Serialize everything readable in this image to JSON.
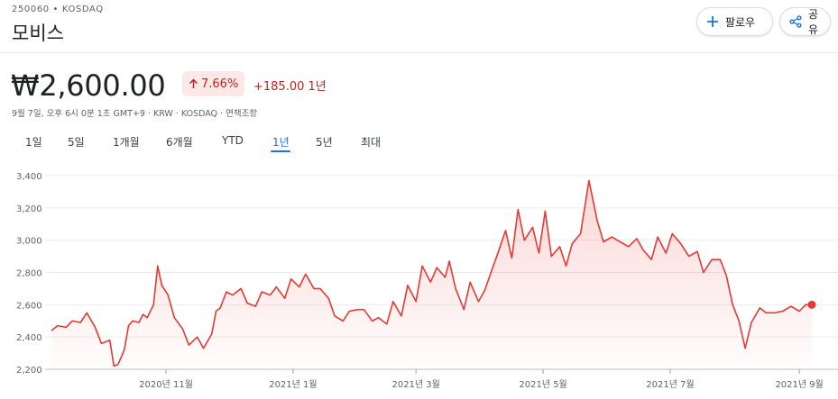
{
  "header": {
    "ticker": "250060 • KOSDAQ",
    "name": "모비스",
    "follow_label": "팔로우",
    "share_label": "공유"
  },
  "quote": {
    "price": "₩2,600.00",
    "change_pct": "7.66%",
    "change_abs": "+185.00 1년",
    "meta": "9월 7일, 오후 6시 0분 1초 GMT+9 · KRW · KOSDAQ · 면책조항"
  },
  "tabs": [
    {
      "label": "1일",
      "active": false
    },
    {
      "label": "5일",
      "active": false
    },
    {
      "label": "1개월",
      "active": false
    },
    {
      "label": "6개월",
      "active": false
    },
    {
      "label": "YTD",
      "active": false
    },
    {
      "label": "1년",
      "active": true
    },
    {
      "label": "5년",
      "active": false
    },
    {
      "label": "최대",
      "active": false
    }
  ],
  "colors": {
    "line": "#e53935",
    "fill": "#fce8e6",
    "accent": "#1a73e8",
    "negative_text": "#c5221f"
  },
  "chart_data": {
    "type": "area",
    "y_ticks": [
      "3,400",
      "3,200",
      "3,000",
      "2,800",
      "2,600",
      "2,400",
      "2,200"
    ],
    "x_ticks": [
      "2020년 11월",
      "2021년 1월",
      "2021년 3월",
      "2021년 5월",
      "2021년 7월",
      "2021년 9월"
    ],
    "ylim": [
      2200,
      3400
    ],
    "x_range": [
      "2020-09-07",
      "2021-09-07"
    ],
    "last_value": 2600,
    "points": [
      [
        "2020-09-07",
        2440
      ],
      [
        "2020-09-10",
        2470
      ],
      [
        "2020-09-14",
        2460
      ],
      [
        "2020-09-17",
        2500
      ],
      [
        "2020-09-21",
        2490
      ],
      [
        "2020-09-24",
        2550
      ],
      [
        "2020-09-28",
        2460
      ],
      [
        "2020-10-01",
        2360
      ],
      [
        "2020-10-05",
        2380
      ],
      [
        "2020-10-07",
        2220
      ],
      [
        "2020-10-09",
        2230
      ],
      [
        "2020-10-12",
        2320
      ],
      [
        "2020-10-14",
        2470
      ],
      [
        "2020-10-16",
        2500
      ],
      [
        "2020-10-19",
        2490
      ],
      [
        "2020-10-21",
        2540
      ],
      [
        "2020-10-23",
        2520
      ],
      [
        "2020-10-26",
        2600
      ],
      [
        "2020-10-28",
        2840
      ],
      [
        "2020-10-30",
        2720
      ],
      [
        "2020-11-02",
        2660
      ],
      [
        "2020-11-05",
        2520
      ],
      [
        "2020-11-09",
        2450
      ],
      [
        "2020-11-12",
        2350
      ],
      [
        "2020-11-16",
        2400
      ],
      [
        "2020-11-19",
        2330
      ],
      [
        "2020-11-23",
        2420
      ],
      [
        "2020-11-25",
        2560
      ],
      [
        "2020-11-27",
        2580
      ],
      [
        "2020-11-30",
        2680
      ],
      [
        "2020-12-03",
        2660
      ],
      [
        "2020-12-07",
        2700
      ],
      [
        "2020-12-10",
        2610
      ],
      [
        "2020-12-14",
        2590
      ],
      [
        "2020-12-17",
        2680
      ],
      [
        "2020-12-21",
        2660
      ],
      [
        "2020-12-24",
        2710
      ],
      [
        "2020-12-28",
        2640
      ],
      [
        "2020-12-31",
        2760
      ],
      [
        "2021-01-04",
        2710
      ],
      [
        "2021-01-07",
        2790
      ],
      [
        "2021-01-11",
        2700
      ],
      [
        "2021-01-14",
        2700
      ],
      [
        "2021-01-18",
        2640
      ],
      [
        "2021-01-21",
        2530
      ],
      [
        "2021-01-25",
        2500
      ],
      [
        "2021-01-28",
        2560
      ],
      [
        "2021-02-01",
        2570
      ],
      [
        "2021-02-04",
        2570
      ],
      [
        "2021-02-08",
        2500
      ],
      [
        "2021-02-11",
        2520
      ],
      [
        "2021-02-15",
        2480
      ],
      [
        "2021-02-18",
        2620
      ],
      [
        "2021-02-22",
        2530
      ],
      [
        "2021-02-25",
        2720
      ],
      [
        "2021-03-01",
        2620
      ],
      [
        "2021-03-04",
        2840
      ],
      [
        "2021-03-08",
        2740
      ],
      [
        "2021-03-11",
        2830
      ],
      [
        "2021-03-15",
        2770
      ],
      [
        "2021-03-17",
        2870
      ],
      [
        "2021-03-20",
        2700
      ],
      [
        "2021-03-24",
        2570
      ],
      [
        "2021-03-27",
        2740
      ],
      [
        "2021-03-31",
        2620
      ],
      [
        "2021-04-03",
        2690
      ],
      [
        "2021-04-06",
        2800
      ],
      [
        "2021-04-09",
        2910
      ],
      [
        "2021-04-13",
        3060
      ],
      [
        "2021-04-16",
        2890
      ],
      [
        "2021-04-19",
        3190
      ],
      [
        "2021-04-22",
        3000
      ],
      [
        "2021-04-26",
        3080
      ],
      [
        "2021-04-29",
        2920
      ],
      [
        "2021-05-02",
        3180
      ],
      [
        "2021-05-05",
        2900
      ],
      [
        "2021-05-09",
        2960
      ],
      [
        "2021-05-12",
        2840
      ],
      [
        "2021-05-15",
        2980
      ],
      [
        "2021-05-19",
        3040
      ],
      [
        "2021-05-23",
        3370
      ],
      [
        "2021-05-27",
        3120
      ],
      [
        "2021-05-30",
        2990
      ],
      [
        "2021-06-03",
        3020
      ],
      [
        "2021-06-07",
        2990
      ],
      [
        "2021-06-11",
        2960
      ],
      [
        "2021-06-15",
        3010
      ],
      [
        "2021-06-18",
        2940
      ],
      [
        "2021-06-22",
        2880
      ],
      [
        "2021-06-25",
        3020
      ],
      [
        "2021-06-29",
        2920
      ],
      [
        "2021-07-02",
        3040
      ],
      [
        "2021-07-06",
        2980
      ],
      [
        "2021-07-10",
        2900
      ],
      [
        "2021-07-14",
        2930
      ],
      [
        "2021-07-17",
        2800
      ],
      [
        "2021-07-21",
        2880
      ],
      [
        "2021-07-25",
        2880
      ],
      [
        "2021-07-28",
        2780
      ],
      [
        "2021-07-31",
        2600
      ],
      [
        "2021-08-03",
        2500
      ],
      [
        "2021-08-06",
        2330
      ],
      [
        "2021-08-09",
        2490
      ],
      [
        "2021-08-13",
        2580
      ],
      [
        "2021-08-16",
        2550
      ],
      [
        "2021-08-20",
        2550
      ],
      [
        "2021-08-24",
        2560
      ],
      [
        "2021-08-28",
        2590
      ],
      [
        "2021-09-01",
        2560
      ],
      [
        "2021-09-04",
        2600
      ],
      [
        "2021-09-07",
        2600
      ]
    ]
  }
}
